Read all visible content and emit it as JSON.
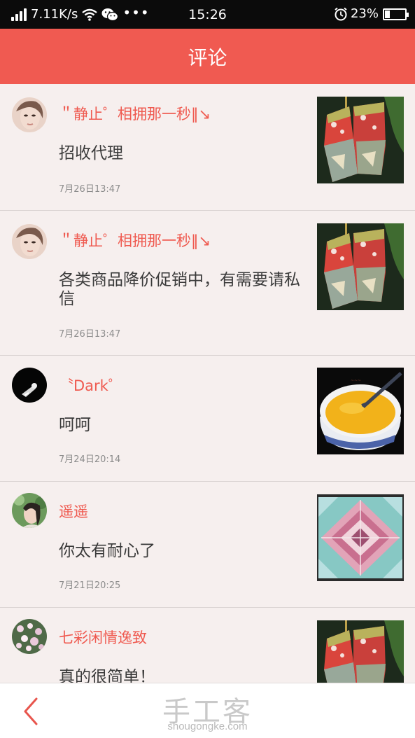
{
  "status_bar": {
    "speed": "7.11K/s",
    "dots": "•••",
    "time": "15:26",
    "battery": "23%",
    "battery_level": 0.23,
    "icons": [
      "signal-icon",
      "wifi-icon",
      "wechat-icon",
      "alarm-icon",
      "battery-icon"
    ]
  },
  "header": {
    "title": "评论"
  },
  "comments": [
    {
      "name": "＂静止゜相拥那一秒‖↘",
      "text": "招收代理",
      "time": "7月26日13:47"
    },
    {
      "name": "＂静止゜相拥那一秒‖↘",
      "text": "各类商品降价促销中，有需要请私信",
      "time": "7月26日13:47"
    },
    {
      "name": "〝Dark゜",
      "text": "呵呵",
      "time": "7月24日20:14"
    },
    {
      "name": "遥遥",
      "text": "你太有耐心了",
      "time": "7月21日20:25"
    },
    {
      "name": "七彩闲情逸致",
      "text": "真的很简单！",
      "time": ""
    }
  ],
  "bottom_bar": {
    "back_icon": "chevron-left-icon",
    "watermark_cn": "手工客",
    "watermark_en": "shougongke.com"
  },
  "colors": {
    "accent": "#f05a51",
    "background": "#f6efee",
    "status_bar": "#0b0b0b"
  }
}
